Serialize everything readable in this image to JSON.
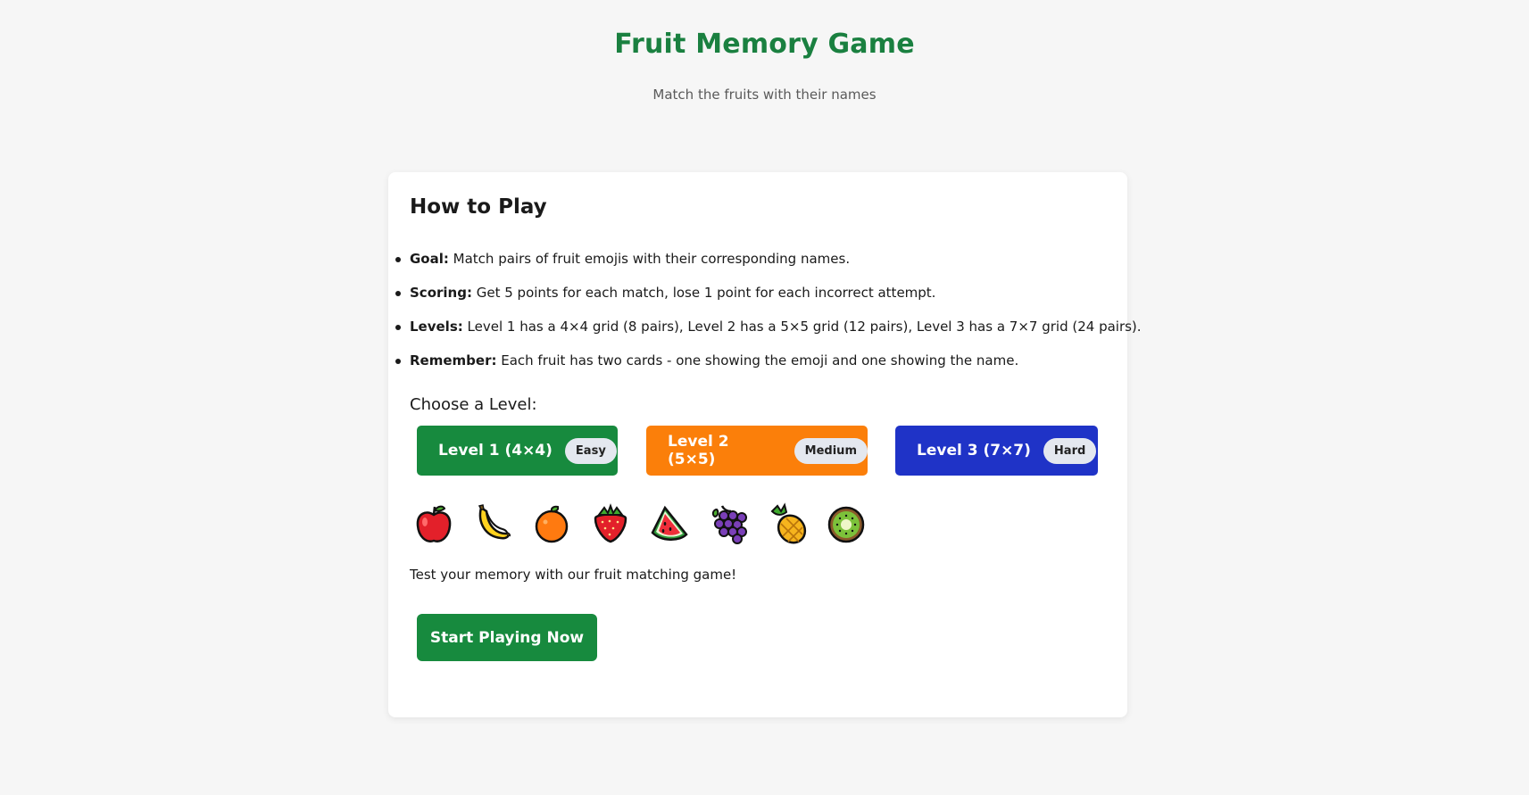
{
  "header": {
    "title": "Fruit Memory Game",
    "subtitle": "Match the fruits with their names"
  },
  "instructions": {
    "title": "How to Play",
    "rules": [
      {
        "label": "Goal:",
        "text": " Match pairs of fruit emojis with their corresponding names."
      },
      {
        "label": "Scoring:",
        "text": " Get 5 points for each match, lose 1 point for each incorrect attempt."
      },
      {
        "label": "Levels:",
        "text": " Level 1 has a 4×4 grid (8 pairs), Level 2 has a 5×5 grid (12 pairs), Level 3 has a 7×7 grid (24 pairs)."
      },
      {
        "label": "Remember:",
        "text": " Each fruit has two cards - one showing the emoji and one showing the name."
      }
    ]
  },
  "level_select": {
    "label": "Choose a Level:",
    "levels": [
      {
        "name": "Level 1 (4×4)",
        "difficulty": "Easy",
        "color": "#178a3e"
      },
      {
        "name": "Level 2 (5×5)",
        "difficulty": "Medium",
        "color": "#fb7f0a"
      },
      {
        "name": "Level 3 (7×7)",
        "difficulty": "Hard",
        "color": "#1f33c7"
      }
    ]
  },
  "fruits": [
    "apple-icon",
    "banana-icon",
    "orange-icon",
    "strawberry-icon",
    "watermelon-icon",
    "grapes-icon",
    "pineapple-icon",
    "kiwi-icon"
  ],
  "tagline": "Test your memory with our fruit matching game!",
  "start_button": "Start Playing Now",
  "colors": {
    "title": "#1a8040",
    "primary": "#178a3e",
    "background": "#f6f6f6"
  }
}
